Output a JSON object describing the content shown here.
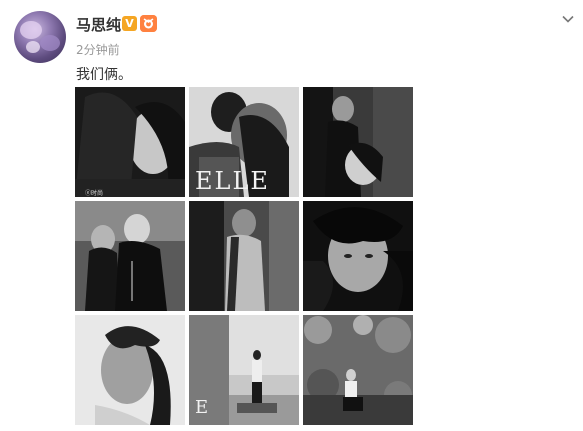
{
  "post": {
    "author": "马思纯",
    "verified_badge": "V",
    "timestamp": "2分钟前",
    "text": "我们俩。"
  },
  "photos": [
    {
      "name": "photo-1",
      "watermark": "ⓔ时尚"
    },
    {
      "name": "photo-2",
      "magazine_mark": "ELLE"
    },
    {
      "name": "photo-3"
    },
    {
      "name": "photo-4"
    },
    {
      "name": "photo-5"
    },
    {
      "name": "photo-6"
    },
    {
      "name": "photo-7"
    },
    {
      "name": "photo-8",
      "magazine_mark": "E"
    },
    {
      "name": "photo-9"
    }
  ],
  "icons": {
    "verified": "verified-v-icon",
    "level": "level-badge-icon",
    "menu": "chevron-down-icon"
  },
  "colors": {
    "name_text": "#333333",
    "time_text": "#999999",
    "verified": "#f5a623",
    "level_badge": "#ff8140"
  }
}
